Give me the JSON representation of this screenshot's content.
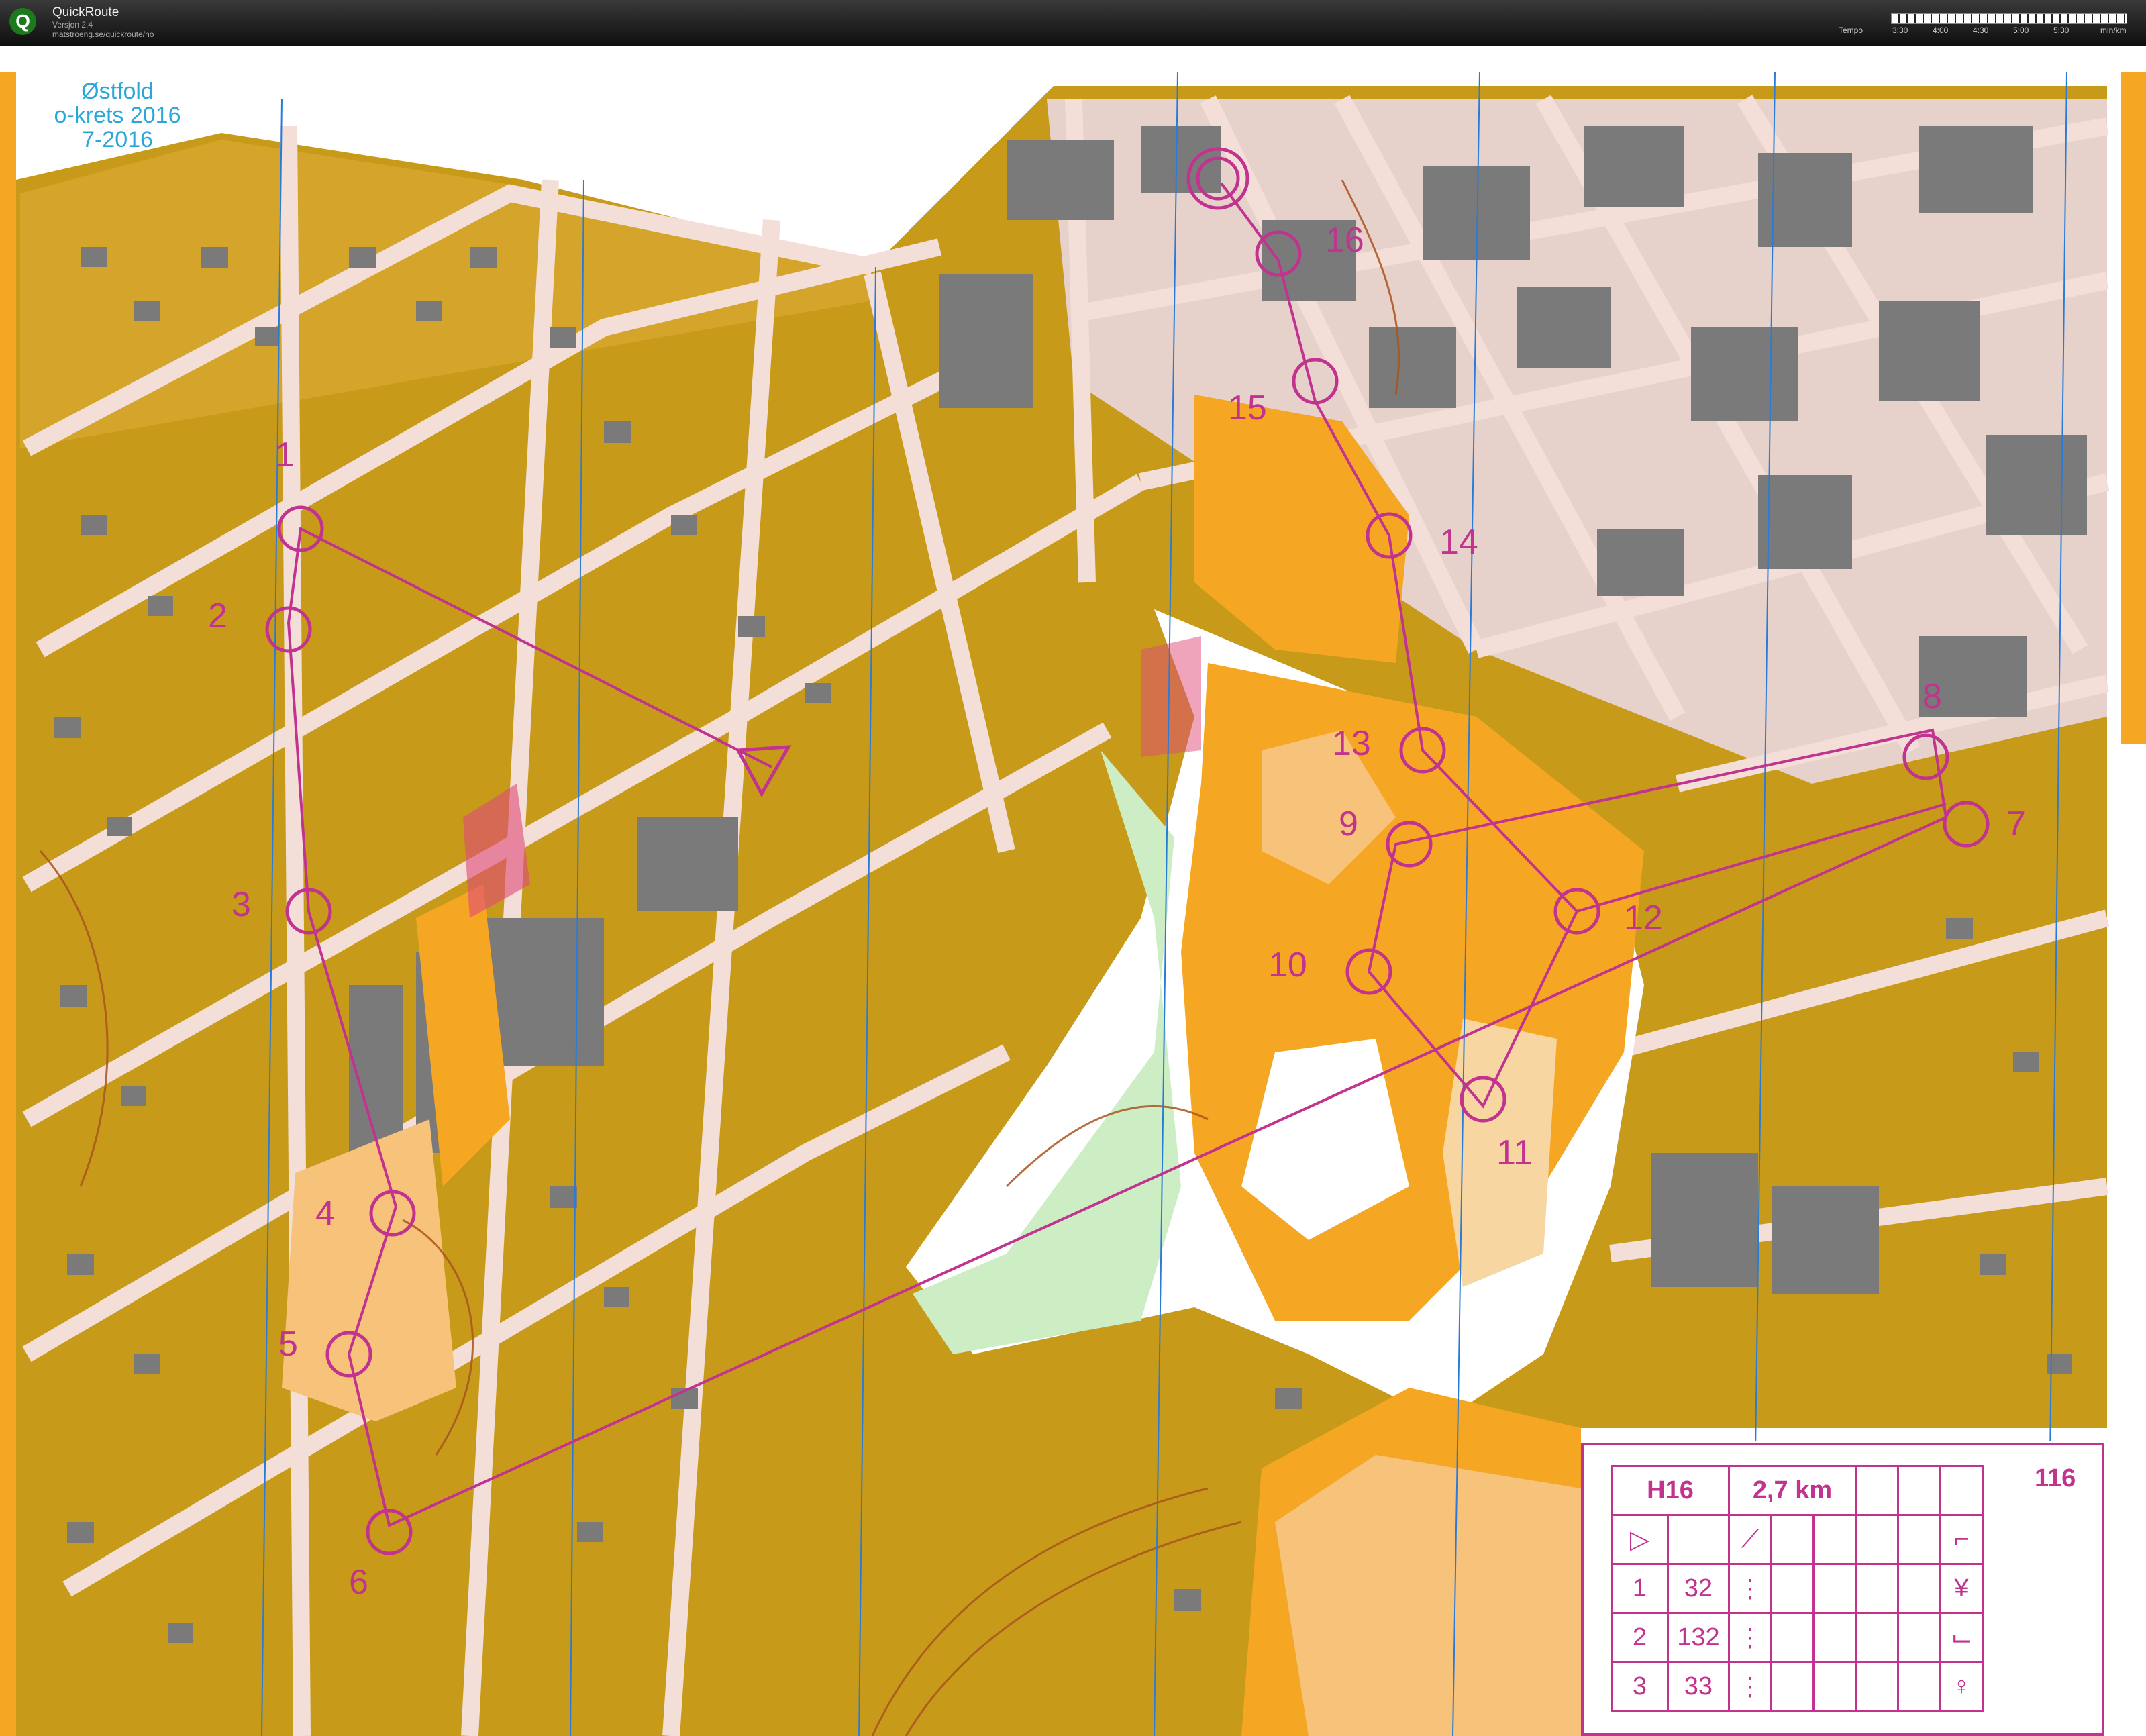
{
  "window": {
    "title": "QuickRoute",
    "version": "Versjon 2.4",
    "url": "matstroeng.se/quickroute/no",
    "logo": "Q"
  },
  "tempo_scale": {
    "label": "Tempo",
    "ticks": [
      "3:30",
      "4:00",
      "4:30",
      "5:00",
      "5:30"
    ],
    "unit": "min/km"
  },
  "map": {
    "header": [
      "Østfold",
      "o-krets 2016",
      "7-2016"
    ],
    "colors": {
      "course": "#c2338f",
      "terrain_open": "#f5a623",
      "terrain_rough": "#c79a1a",
      "road": "#f3dfd8",
      "building": "#7a7a7a",
      "forest_runnable": "#ffffff",
      "vegetation_green": "#a9e4a0",
      "meridian": "#2a7bd8"
    },
    "controls": [
      "1",
      "2",
      "3",
      "4",
      "5",
      "6",
      "7",
      "8",
      "9",
      "10",
      "11",
      "12",
      "13",
      "14",
      "15",
      "16"
    ],
    "start_symbol": "triangle",
    "finish_symbol": "double-circle"
  },
  "legend": {
    "class": "H16",
    "distance": "2,7 km",
    "course_number": "116",
    "rows": [
      {
        "num": "1",
        "code": "32"
      },
      {
        "num": "2",
        "code": "132"
      },
      {
        "num": "3",
        "code": "33"
      }
    ],
    "start_row_symbol": "▷"
  }
}
